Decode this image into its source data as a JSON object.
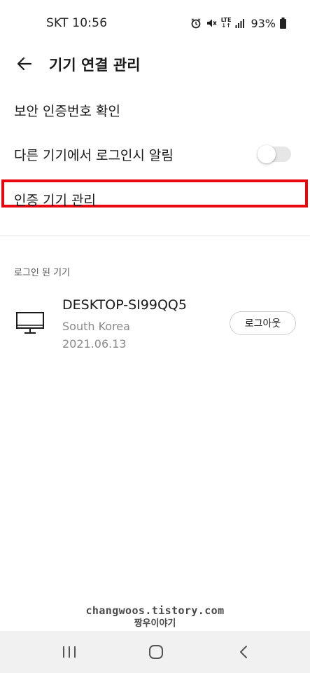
{
  "status_bar": {
    "carrier": "SKT",
    "time": "10:56",
    "network": "LTE",
    "battery": "93%"
  },
  "header": {
    "title": "기기 연결 관리"
  },
  "settings": {
    "pin_check": "보안 인증번호 확인",
    "login_notify": "다른 기기에서 로그인시 알림",
    "login_notify_enabled": false,
    "auth_devices": "인증 기기 관리"
  },
  "logged_in": {
    "section_label": "로그인 된 기기",
    "devices": [
      {
        "name": "DESKTOP-SI99QQ5",
        "country": "South Korea",
        "date": "2021.06.13",
        "logout_label": "로그아웃"
      }
    ]
  },
  "watermark": {
    "site": "changwoos.tistory.com",
    "name": "짱우이야기"
  },
  "colors": {
    "highlight": "#e8070e",
    "toggle_track": "#e6e6e6",
    "nav_bar": "#f1f1f1"
  },
  "icons": [
    "back-arrow-icon",
    "alarm-icon",
    "mute-icon",
    "signal-icon",
    "battery-icon",
    "monitor-icon",
    "recents-icon",
    "home-icon",
    "chevron-back-icon"
  ]
}
